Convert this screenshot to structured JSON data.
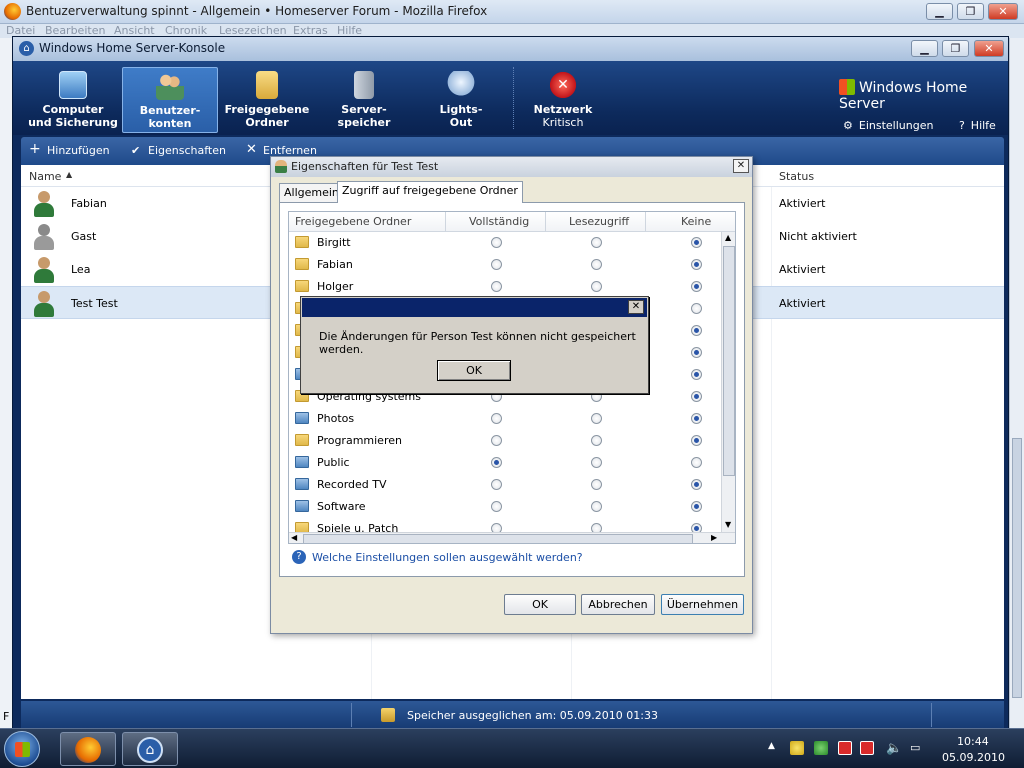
{
  "firefox": {
    "title": "Bentuzerverwaltung spinnt - Allgemein • Homeserver Forum - Mozilla Firefox",
    "menu": [
      "Datei",
      "Bearbeiten",
      "Ansicht",
      "Chronik",
      "Lesezeichen",
      "Extras",
      "Hilfe"
    ],
    "caption": {
      "min": "▁",
      "max": "❐",
      "close": "✕"
    },
    "left_letters": [
      "F"
    ]
  },
  "console": {
    "title": "Windows Home Server-Konsole",
    "brand": "Windows Home Server",
    "nav": [
      {
        "line1": "Computer",
        "line2": "und Sicherung",
        "icon": "computer-icon"
      },
      {
        "line1": "Benutzer-",
        "line2": "konten",
        "icon": "users-icon",
        "active": true
      },
      {
        "line1": "Freigegebene",
        "line2": "Ordner",
        "icon": "shared-folders-icon"
      },
      {
        "line1": "Server-",
        "line2": "speicher",
        "icon": "server-storage-icon"
      },
      {
        "line1": "Lights-",
        "line2": "Out",
        "icon": "lightbulb-icon"
      },
      {
        "line1": "Netzwerk",
        "line2": "Kritisch",
        "icon": "network-critical-icon"
      }
    ],
    "settings_label": "Einstellungen",
    "help_label": "Hilfe",
    "toolbar": {
      "add": "Hinzufügen",
      "props": "Eigenschaften",
      "remove": "Entfernen"
    },
    "list": {
      "col_name": "Name",
      "col_status": "Status",
      "users": [
        {
          "name": "Fabian",
          "status": "Aktiviert"
        },
        {
          "name": "Gast",
          "status": "Nicht aktiviert"
        },
        {
          "name": "Lea",
          "status": "Aktiviert"
        },
        {
          "name": "Test Test",
          "status": "Aktiviert",
          "selected": true
        }
      ]
    },
    "statusbar": "Speicher ausgeglichen am: 05.09.2010 01:33"
  },
  "props_dialog": {
    "title": "Eigenschaften für Test Test",
    "tabs": [
      "Allgemein",
      "Zugriff auf freigegebene Ordner"
    ],
    "columns": [
      "Freigegebene Ordner",
      "Vollständig",
      "Lesezugriff",
      "Keine"
    ],
    "rows": [
      {
        "name": "Birgitt",
        "access": "none",
        "icon": "folder"
      },
      {
        "name": "Fabian",
        "access": "none",
        "icon": "folder"
      },
      {
        "name": "Holger",
        "access": "none",
        "icon": "folder"
      },
      {
        "name": "",
        "access": "",
        "icon": "folder"
      },
      {
        "name": "",
        "access": "none",
        "icon": "folder"
      },
      {
        "name": "",
        "access": "none",
        "icon": "folder"
      },
      {
        "name": "",
        "access": "none",
        "icon": "net"
      },
      {
        "name": "Operating systems",
        "access": "none",
        "icon": "folder"
      },
      {
        "name": "Photos",
        "access": "none",
        "icon": "net"
      },
      {
        "name": "Programmieren",
        "access": "none",
        "icon": "folder"
      },
      {
        "name": "Public",
        "access": "full",
        "icon": "net"
      },
      {
        "name": "Recorded TV",
        "access": "none",
        "icon": "net"
      },
      {
        "name": "Software",
        "access": "none",
        "icon": "net"
      },
      {
        "name": "Spiele u. Patch",
        "access": "none",
        "icon": "folder"
      }
    ],
    "help_link": "Welche Einstellungen sollen ausgewählt werden?",
    "ok": "OK",
    "cancel": "Abbrechen",
    "apply": "Übernehmen"
  },
  "message_box": {
    "text": "Die Änderungen für Person Test können nicht gespeichert werden.",
    "ok": "OK"
  },
  "taskbar": {
    "time": "10:44",
    "date": "05.09.2010"
  },
  "colors": {
    "accent": "#2a5fa8",
    "console_bg": "#0d2a5c",
    "critical": "#d92b2b"
  }
}
